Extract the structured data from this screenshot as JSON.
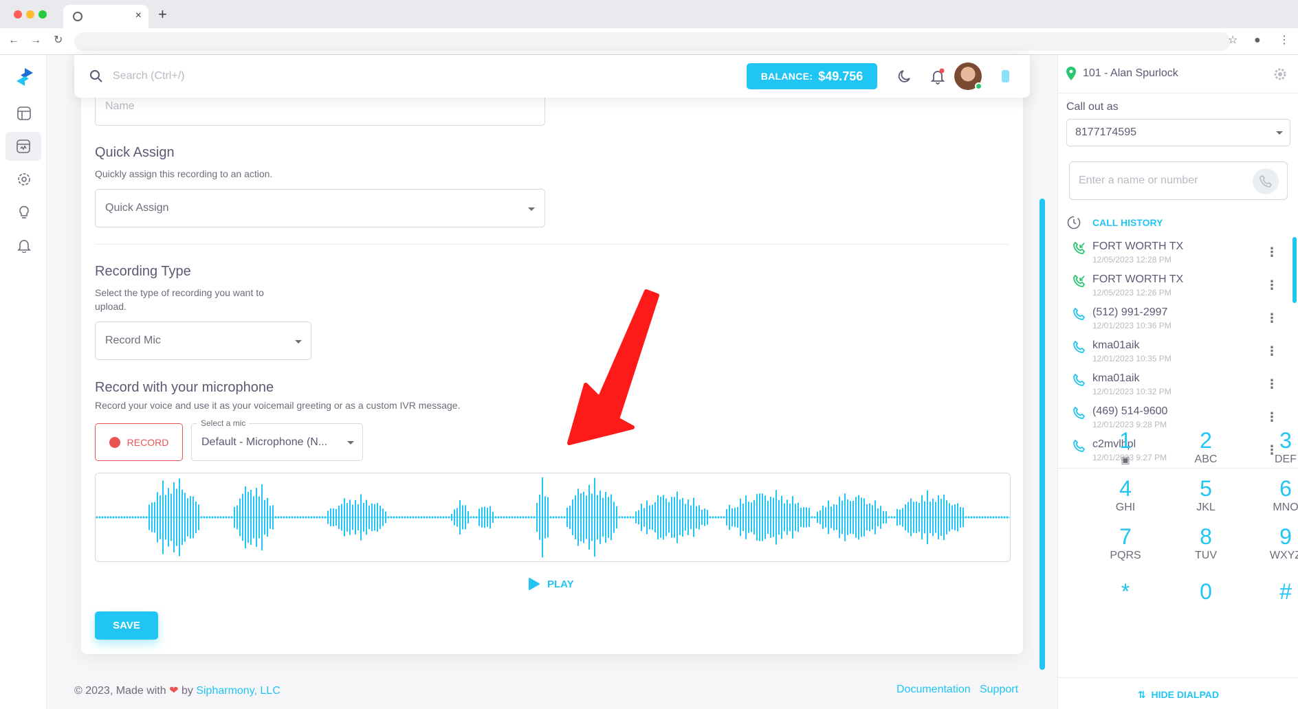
{
  "browser": {
    "tab_close": "×",
    "new_tab": "+"
  },
  "topbar": {
    "search_placeholder": "Search (Ctrl+/)",
    "balance_label": "BALANCE:",
    "balance_amount": "$49.756"
  },
  "form": {
    "name_placeholder": "Name",
    "quick_assign_title": "Quick Assign",
    "quick_assign_sub": "Quickly assign this recording to an action.",
    "quick_assign_placeholder": "Quick Assign",
    "recording_type_title": "Recording Type",
    "recording_type_sub_1": "Select the type of recording you want to",
    "recording_type_sub_2": "upload.",
    "recording_type_value": "Record Mic",
    "mic_title": "Record with your microphone",
    "mic_sub": "Record your voice and use it as your voicemail greeting or as a custom IVR message.",
    "record_label": "RECORD",
    "select_mic_label": "Select a mic",
    "select_mic_value": "Default - Microphone (N...",
    "play_label": "PLAY",
    "save_label": "SAVE"
  },
  "footer": {
    "copyright": "© 2023, Made with",
    "by": "by",
    "company": "Sipharmony, LLC",
    "documentation": "Documentation",
    "support": "Support"
  },
  "dialer": {
    "extension": "101 - Alan Spurlock",
    "call_out_label": "Call out as",
    "call_out_value": "8177174595",
    "input_placeholder": "Enter a name or number",
    "history_title": "CALL HISTORY",
    "history": [
      {
        "name": "FORT WORTH TX",
        "time": "12/05/2023 12:28 PM",
        "type": "incoming"
      },
      {
        "name": "FORT WORTH TX",
        "time": "12/05/2023 12:26 PM",
        "type": "incoming"
      },
      {
        "name": "(512) 991-2997",
        "time": "12/01/2023 10:36 PM",
        "type": "outgoing"
      },
      {
        "name": "kma01aik",
        "time": "12/01/2023 10:35 PM",
        "type": "outgoing"
      },
      {
        "name": "kma01aik",
        "time": "12/01/2023 10:32 PM",
        "type": "outgoing"
      },
      {
        "name": "(469) 514-9600",
        "time": "12/01/2023 9:28 PM",
        "type": "outgoing"
      },
      {
        "name": "c2mvlhpl",
        "time": "12/01/2023 9:27 PM",
        "type": "outgoing"
      }
    ],
    "keypad": [
      {
        "digit": "1",
        "letters": ""
      },
      {
        "digit": "2",
        "letters": "ABC"
      },
      {
        "digit": "3",
        "letters": "DEF"
      },
      {
        "digit": "4",
        "letters": "GHI"
      },
      {
        "digit": "5",
        "letters": "JKL"
      },
      {
        "digit": "6",
        "letters": "MNO"
      },
      {
        "digit": "7",
        "letters": "PQRS"
      },
      {
        "digit": "8",
        "letters": "TUV"
      },
      {
        "digit": "9",
        "letters": "WXYZ"
      },
      {
        "digit": "*",
        "letters": ""
      },
      {
        "digit": "0",
        "letters": ""
      },
      {
        "digit": "#",
        "letters": ""
      }
    ],
    "hide_dialpad": "HIDE DIALPAD"
  },
  "colors": {
    "accent": "#21c5f3",
    "danger": "#ea5455",
    "incoming": "#28c76f",
    "outgoing": "#21c5f3",
    "annotation_arrow": "#ff1a1a"
  },
  "icons": [
    "logo-icon",
    "dashboard-icon",
    "recordings-icon",
    "settings-icon",
    "lightbulb-icon",
    "bell-icon",
    "search-icon",
    "moon-icon",
    "notification-icon",
    "phone-device-icon",
    "location-pin-icon",
    "gear-icon",
    "phone-icon",
    "history-clock-icon",
    "voicemail-icon",
    "play-icon",
    "heart-icon",
    "chevron-collapse-icon"
  ]
}
